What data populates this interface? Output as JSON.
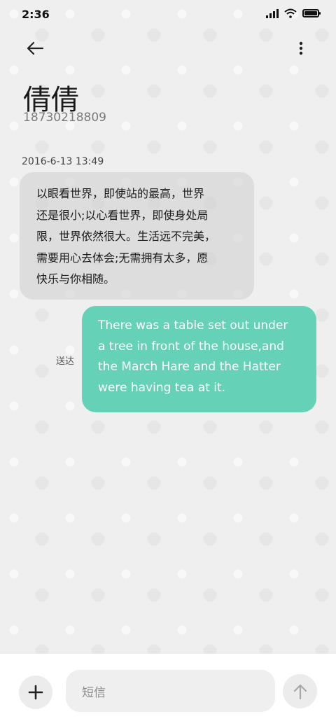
{
  "status_bar": {
    "time": "2:36",
    "battery_level": 1.0
  },
  "header": {
    "back_icon": "arrow-left-icon",
    "more_icon": "more-vertical-icon",
    "contact_name": "倩倩",
    "contact_number": "18730218809"
  },
  "messages": [
    {
      "direction": "incoming",
      "timestamp": "2016-6-13 13:49",
      "lines": [
        "以眼看世界，即使站的最高，世界",
        "还是很小;以心看世界，即使身处局",
        "限，世界依然很大。生活远不完美，",
        "需要用心去体会;无需拥有太多，愿",
        "快乐与你相随。"
      ]
    },
    {
      "direction": "outgoing",
      "status": "送达",
      "lines": [
        "There was a table set out under",
        "a tree in front of the house,and",
        "the March Hare and the Hatter",
        "were having tea at it."
      ]
    }
  ],
  "composer": {
    "placeholder": "短信",
    "add_icon": "plus-icon",
    "send_icon": "arrow-up-icon"
  },
  "colors": {
    "outgoing_bubble": "#65d2b7",
    "incoming_bubble": "#d6d6d6",
    "background": "#efefef"
  }
}
